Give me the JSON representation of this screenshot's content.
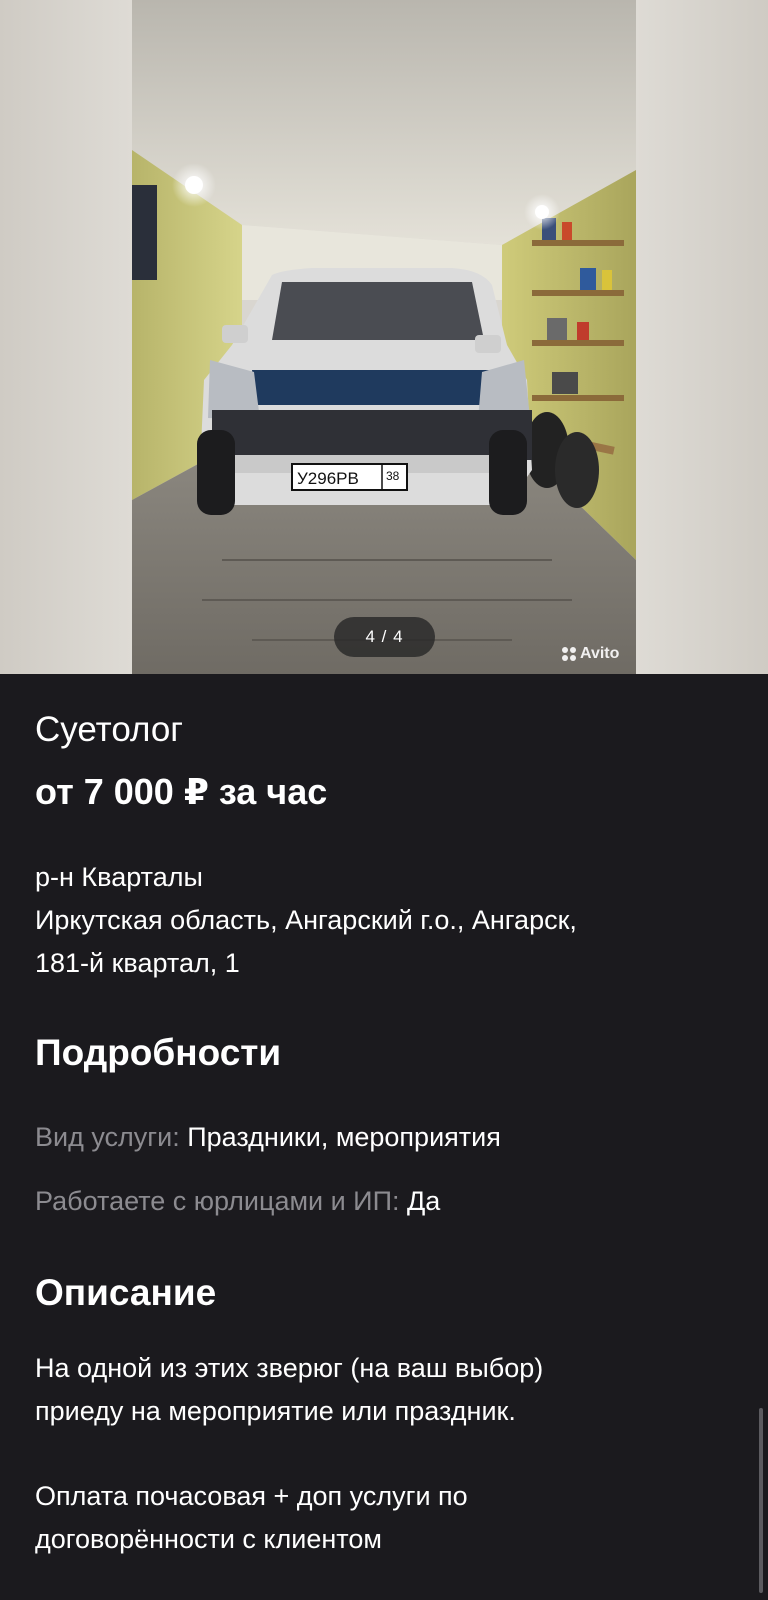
{
  "gallery": {
    "counter": "4 / 4",
    "watermark": "Avito",
    "plate_number": "У296РВ",
    "plate_region": "38"
  },
  "listing": {
    "title": "Суетолог",
    "price": "от 7 000 ₽ за час",
    "district": "р-н Кварталы",
    "address_line1": "Иркутская область, Ангарский г.о., Ангарск,",
    "address_line2": "181-й квартал, 1"
  },
  "details": {
    "heading": "Подробности",
    "params": [
      {
        "key": "Вид услуги:",
        "value": "Праздники, мероприятия"
      },
      {
        "key": "Работаете с юрлицами и ИП:",
        "value": "Да"
      }
    ]
  },
  "description": {
    "heading": "Описание",
    "paragraph1_line1": "На одной из этих зверюг (на ваш выбор)",
    "paragraph1_line2": "приеду на мероприятие или праздник.",
    "paragraph2_line1": "Оплата почасовая + доп услуги по",
    "paragraph2_line2": "договорённости с клиентом"
  },
  "icons": {
    "watermark_logo": "avito-dots-icon"
  },
  "colors": {
    "background": "#1b1a1e",
    "text": "#ffffff",
    "muted_text": "#8c8b90"
  }
}
